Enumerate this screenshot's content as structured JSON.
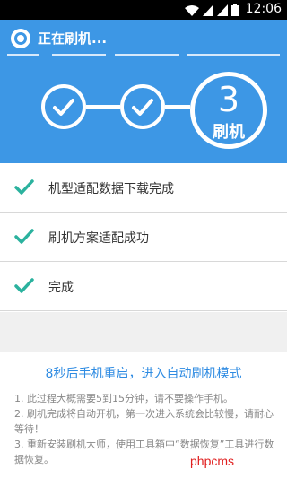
{
  "status_bar": {
    "time": "12:06",
    "icons": [
      "wifi-icon",
      "signal-icon",
      "signal-icon",
      "battery-icon"
    ]
  },
  "header": {
    "title": "正在刷机...",
    "steps": [
      {
        "state": "done",
        "icon": "check-icon"
      },
      {
        "state": "done",
        "icon": "check-icon"
      },
      {
        "state": "current",
        "number": "3",
        "label": "刷机"
      }
    ]
  },
  "tasks": [
    {
      "label": "机型适配数据下载完成",
      "icon": "check-icon"
    },
    {
      "label": "刷机方案适配成功",
      "icon": "check-icon"
    },
    {
      "label": "完成",
      "icon": "check-icon"
    }
  ],
  "message": "8秒后手机重启，进入自动刷机模式",
  "notes": [
    "1. 此过程大概需要5到15分钟，请不要操作手机。",
    "2. 刷机完成将自动开机，第一次进入系统会比较慢，请耐心等待！",
    "3. 重新安装刷机大师，使用工具箱中“数据恢复”工具进行数据恢复。"
  ],
  "watermark": "phpcms",
  "colors": {
    "primary": "#3d97e5",
    "check": "#2bb29e",
    "message": "#2e8be2"
  }
}
